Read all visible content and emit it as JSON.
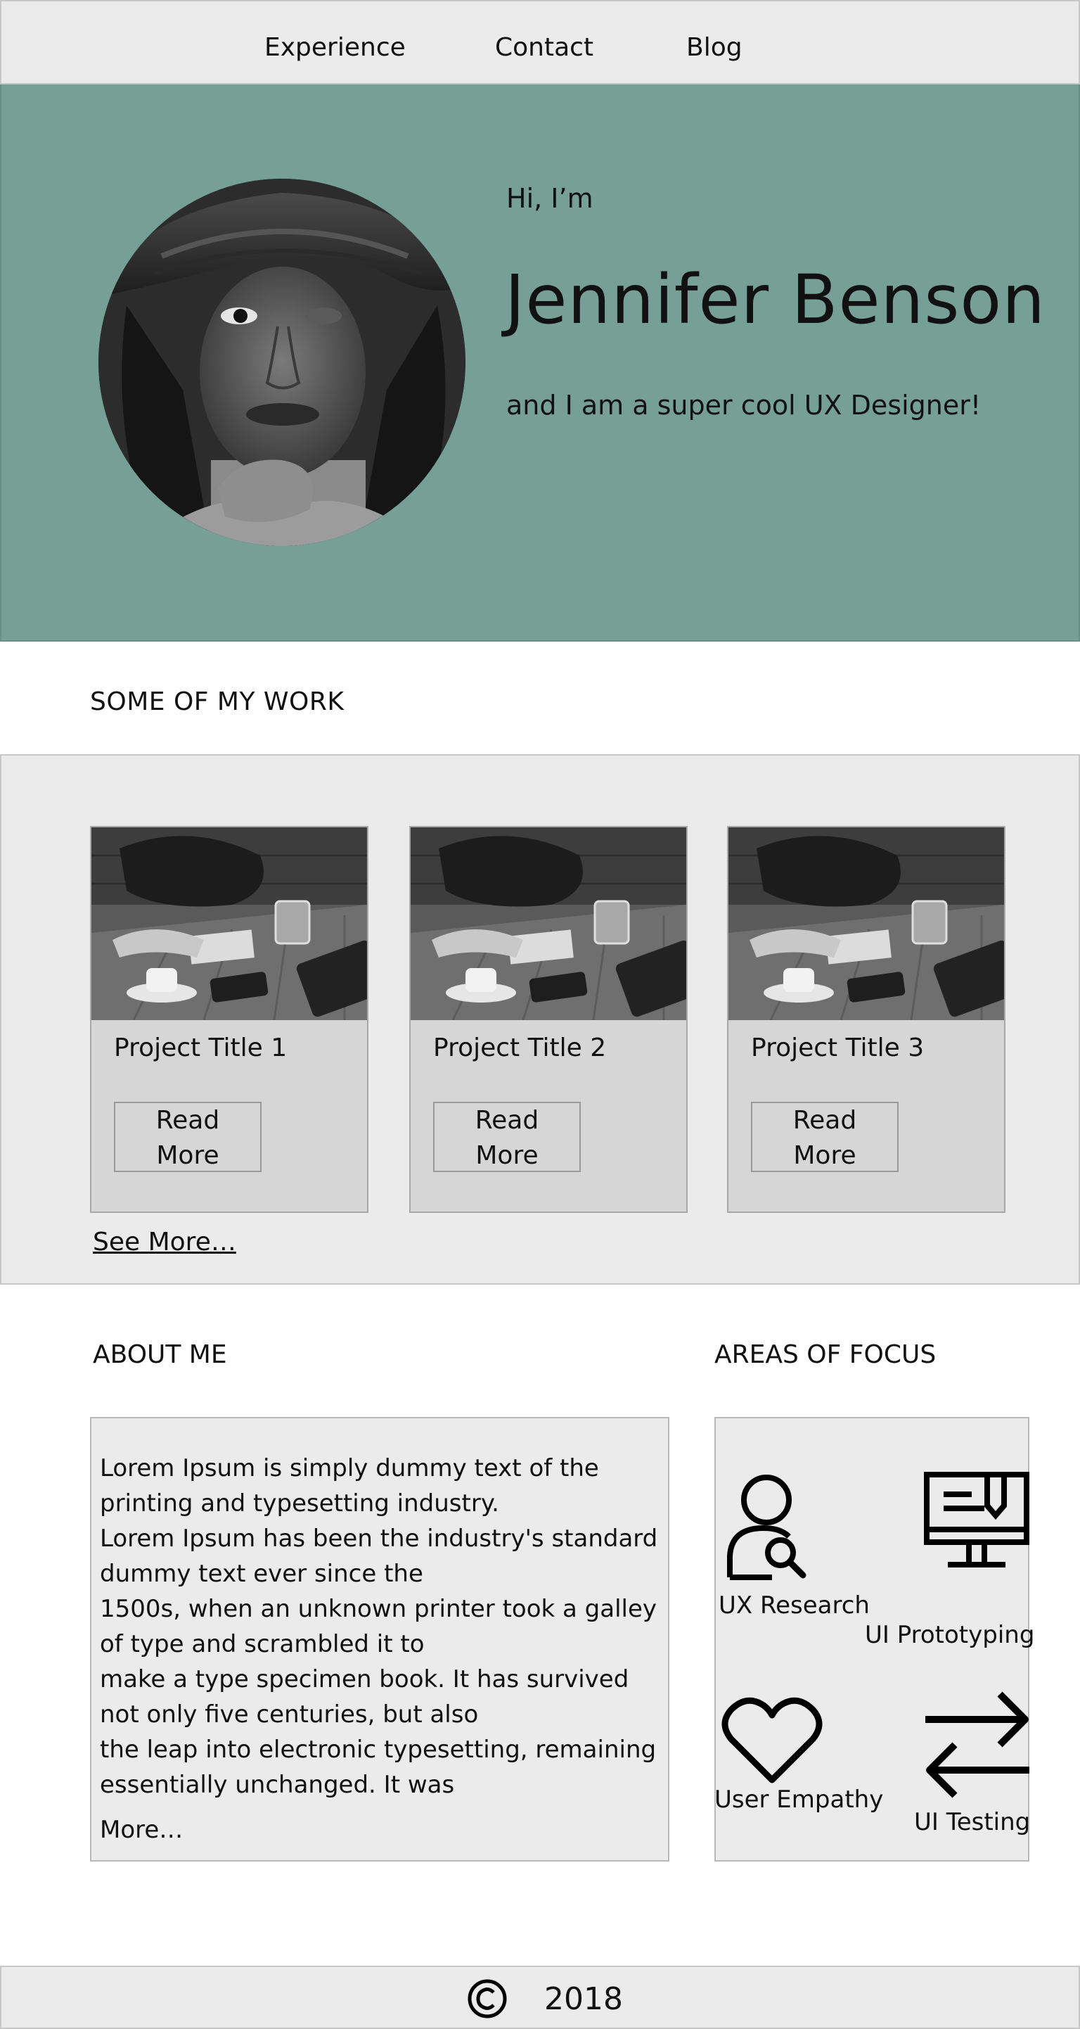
{
  "nav": {
    "items": [
      "Experience",
      "Contact",
      "Blog"
    ]
  },
  "hero": {
    "greeting": "Hi, I’m",
    "name": "Jennifer Benson",
    "tagline": "and I am a super cool UX Designer!"
  },
  "work": {
    "heading": "SOME OF MY WORK",
    "cards": [
      {
        "title": "Project Title 1",
        "button": "Read More"
      },
      {
        "title": "Project Title 2",
        "button": "Read More"
      },
      {
        "title": "Project Title 3",
        "button": "Read More"
      }
    ],
    "see_more": "See More…"
  },
  "about": {
    "heading": "ABOUT ME",
    "text": "Lorem Ipsum is simply dummy text of the printing and typesetting industry.\nLorem Ipsum has been the industry's standard dummy text ever since the\n1500s, when an unknown printer took a galley of type and scrambled it to\nmake a type specimen book. It has survived not only five centuries, but also\n the leap into electronic typesetting, remaining essentially unchanged. It was",
    "more": "More…"
  },
  "focus": {
    "heading": "AREAS OF FOCUS",
    "items": [
      {
        "label": "UX Research",
        "icon": "user-search-icon"
      },
      {
        "label": "UI Prototyping",
        "icon": "monitor-design-icon"
      },
      {
        "label": "User Empathy",
        "icon": "heart-icon"
      },
      {
        "label": "UI Testing",
        "icon": "swap-arrows-icon"
      }
    ]
  },
  "footer": {
    "year": "2018",
    "icon": "copyright-icon"
  },
  "colors": {
    "hero_bg": "#76a095",
    "band_bg": "#ebebeb",
    "card_bg": "#d6d6d6"
  }
}
